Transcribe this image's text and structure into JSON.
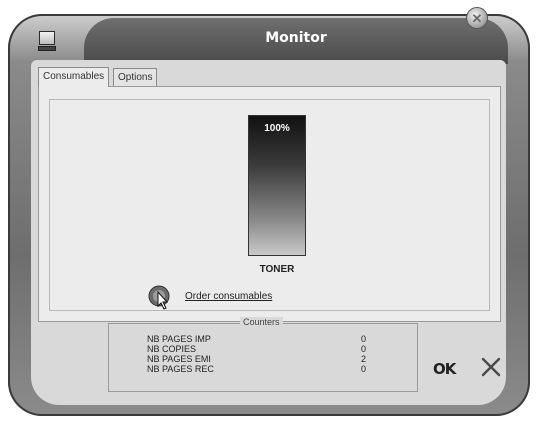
{
  "window": {
    "title": "Monitor"
  },
  "tabs": [
    {
      "label": "Consumables",
      "active": true
    },
    {
      "label": "Options",
      "active": false
    }
  ],
  "toner": {
    "percent_text": "100%",
    "level": 1.0,
    "label": "TONER"
  },
  "order": {
    "link_text": "Order consumables"
  },
  "counters": {
    "legend": "Counters",
    "rows": [
      {
        "label": "NB PAGES IMP",
        "value": "0"
      },
      {
        "label": "NB COPIES",
        "value": "0"
      },
      {
        "label": "NB PAGES EMI",
        "value": "2"
      },
      {
        "label": "NB PAGES REC",
        "value": "0"
      }
    ]
  },
  "buttons": {
    "ok_label": "OK"
  },
  "icons": {
    "app": "monitor-icon",
    "close": "close-icon",
    "order": "cursor-click-icon",
    "cancel": "x-icon"
  }
}
